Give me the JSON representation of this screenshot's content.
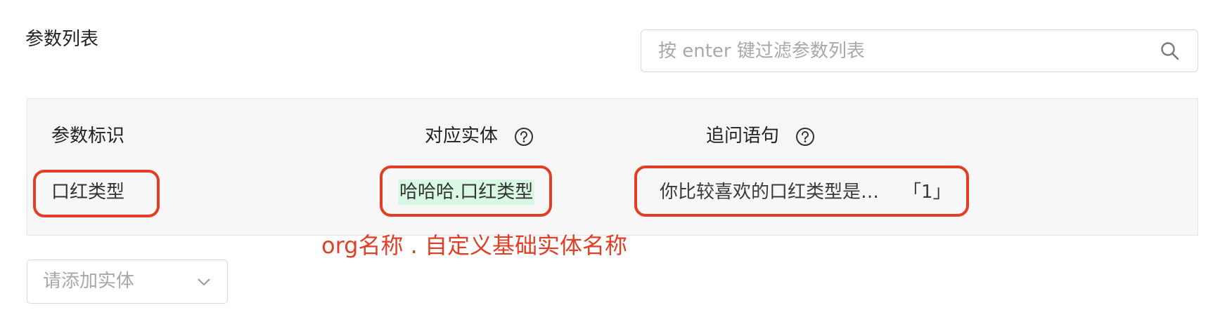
{
  "section": {
    "title": "参数列表"
  },
  "search": {
    "placeholder": "按 enter 键过滤参数列表",
    "value": "",
    "icon": "search-icon"
  },
  "table": {
    "columns": [
      {
        "label": "参数标识",
        "help": false
      },
      {
        "label": "对应实体",
        "help": true,
        "help_icon": "question-circle-icon"
      },
      {
        "label": "追问语句",
        "help": true,
        "help_icon": "question-circle-icon"
      }
    ],
    "rows": [
      {
        "param_id": "口红类型",
        "entity": "哈哈哈.口红类型",
        "question": "你比较喜欢的口红类型是…",
        "question_count": "「1」"
      }
    ]
  },
  "annotation": {
    "text": "org名称 . 自定义基础实体名称",
    "color": "#e23e26"
  },
  "entity_select": {
    "placeholder": "请添加实体",
    "icon": "chevron-down-icon"
  },
  "colors": {
    "annotation": "#e23e26",
    "entity_highlight": "#d8f8e4",
    "border": "#d9d9d9"
  }
}
